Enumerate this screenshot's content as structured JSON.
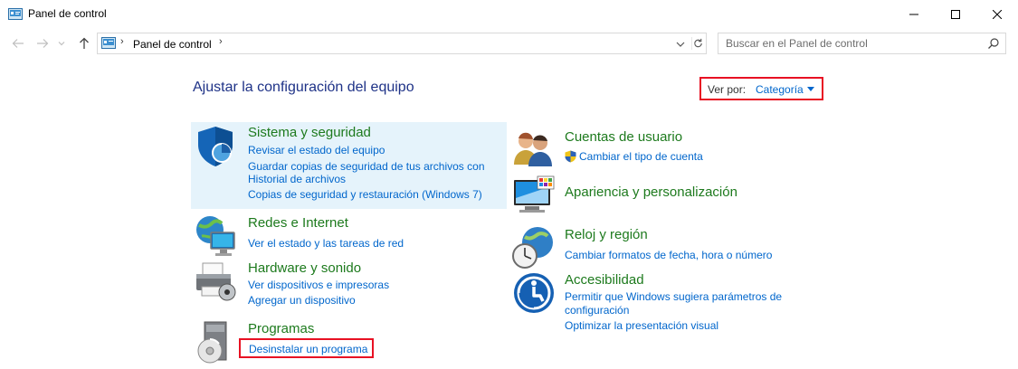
{
  "window": {
    "title": "Panel de control"
  },
  "address_bar": {
    "breadcrumb": "Panel de control",
    "separator": "›"
  },
  "search": {
    "placeholder": "Buscar en el Panel de control"
  },
  "main": {
    "title": "Ajustar la configuración del equipo",
    "view_by": {
      "label": "Ver por:",
      "value": "Categoría"
    }
  },
  "categories": {
    "system": {
      "title": "Sistema y seguridad",
      "links": [
        "Revisar el estado del equipo",
        "Guardar copias de seguridad de tus archivos con",
        "Historial de archivos",
        "Copias de seguridad y restauración (Windows 7)"
      ]
    },
    "network": {
      "title": "Redes e Internet",
      "links": [
        "Ver el estado y las tareas de red"
      ]
    },
    "hardware": {
      "title": "Hardware y sonido",
      "links": [
        "Ver dispositivos e impresoras",
        "Agregar un dispositivo"
      ]
    },
    "programs": {
      "title": "Programas",
      "links": [
        "Desinstalar un programa"
      ]
    },
    "accounts": {
      "title": "Cuentas de usuario",
      "links": [
        "Cambiar el tipo de cuenta"
      ]
    },
    "appearance": {
      "title": "Apariencia y personalización",
      "links": []
    },
    "clock": {
      "title": "Reloj y región",
      "links": [
        "Cambiar formatos de fecha, hora o número"
      ]
    },
    "access": {
      "title": "Accesibilidad",
      "links": [
        "Permitir que Windows sugiera parámetros de",
        "configuración",
        "Optimizar la presentación visual"
      ]
    }
  },
  "colors": {
    "category_heading": "#1d7a1d",
    "link": "#0066cc",
    "title": "#1e3287",
    "highlight_border": "#e81123",
    "hover_bg": "#e5f3fb"
  }
}
